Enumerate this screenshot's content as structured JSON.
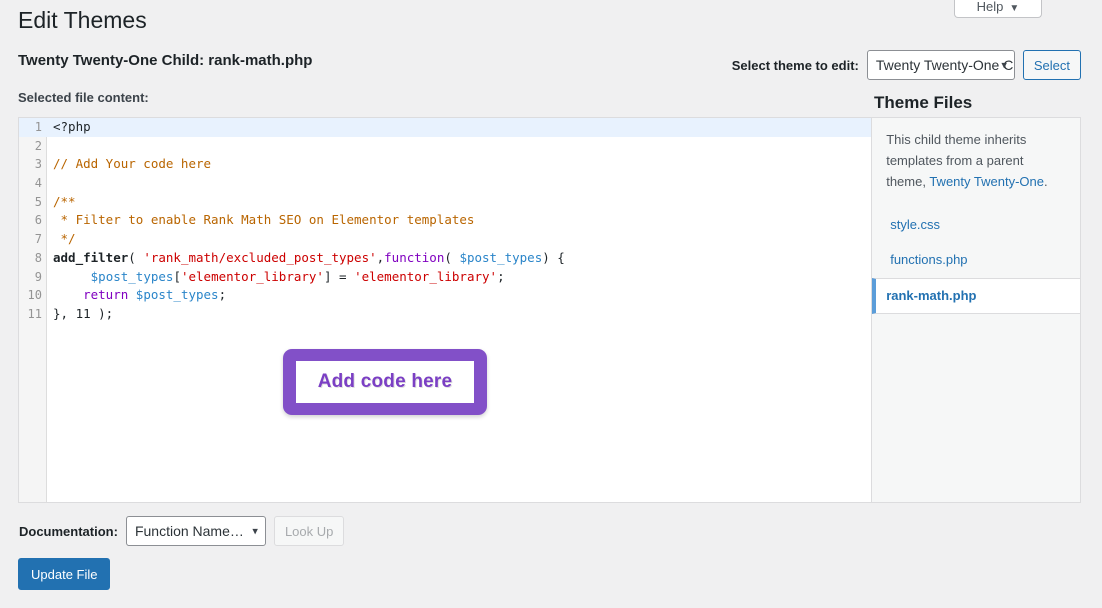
{
  "help_tab": {
    "label": "Help",
    "caret": "chevron-down-icon"
  },
  "header": {
    "page_title": "Edit Themes",
    "file_heading": "Twenty Twenty-One Child: rank-math.php",
    "selected_file_label": "Selected file content:"
  },
  "theme_selector": {
    "label": "Select theme to edit:",
    "value": "Twenty Twenty-One Child",
    "select_button": "Select"
  },
  "editor": {
    "lines": [
      {
        "n": "1",
        "active": true,
        "tokens": [
          {
            "t": "<?php",
            "c": "tok-plain"
          }
        ]
      },
      {
        "n": "2",
        "active": false,
        "tokens": [
          {
            "t": "",
            "c": "tok-plain"
          }
        ]
      },
      {
        "n": "3",
        "active": false,
        "tokens": [
          {
            "t": "// Add Your code here",
            "c": "tok-comment"
          }
        ]
      },
      {
        "n": "4",
        "active": false,
        "tokens": [
          {
            "t": "",
            "c": "tok-plain"
          }
        ]
      },
      {
        "n": "5",
        "active": false,
        "tokens": [
          {
            "t": "/**",
            "c": "tok-comment"
          }
        ]
      },
      {
        "n": "6",
        "active": false,
        "tokens": [
          {
            "t": " * Filter to enable Rank Math SEO on Elementor templates",
            "c": "tok-comment"
          }
        ]
      },
      {
        "n": "7",
        "active": false,
        "tokens": [
          {
            "t": " */",
            "c": "tok-comment"
          }
        ]
      },
      {
        "n": "8",
        "active": false,
        "tokens": [
          {
            "t": "add_filter",
            "c": "tok-fn"
          },
          {
            "t": "( ",
            "c": "tok-plain"
          },
          {
            "t": "'rank_math/excluded_post_types'",
            "c": "tok-string"
          },
          {
            "t": ",",
            "c": "tok-plain"
          },
          {
            "t": "function",
            "c": "tok-kw"
          },
          {
            "t": "( ",
            "c": "tok-plain"
          },
          {
            "t": "$post_types",
            "c": "tok-var"
          },
          {
            "t": ") {",
            "c": "tok-plain"
          }
        ]
      },
      {
        "n": "9",
        "active": false,
        "tokens": [
          {
            "t": "     ",
            "c": "tok-plain"
          },
          {
            "t": "$post_types",
            "c": "tok-var"
          },
          {
            "t": "[",
            "c": "tok-plain"
          },
          {
            "t": "'elementor_library'",
            "c": "tok-string"
          },
          {
            "t": "] = ",
            "c": "tok-plain"
          },
          {
            "t": "'elementor_library'",
            "c": "tok-string"
          },
          {
            "t": ";",
            "c": "tok-plain"
          }
        ]
      },
      {
        "n": "10",
        "active": false,
        "tokens": [
          {
            "t": "    ",
            "c": "tok-plain"
          },
          {
            "t": "return",
            "c": "tok-kw"
          },
          {
            "t": " ",
            "c": "tok-plain"
          },
          {
            "t": "$post_types",
            "c": "tok-var"
          },
          {
            "t": ";",
            "c": "tok-plain"
          }
        ]
      },
      {
        "n": "11",
        "active": false,
        "tokens": [
          {
            "t": "}, 11 );",
            "c": "tok-plain"
          }
        ]
      }
    ]
  },
  "annotation": {
    "text": "Add code here",
    "color": "#8250c8",
    "text_color": "#7b3fc4"
  },
  "sidebar": {
    "heading": "Theme Files",
    "note_prefix": "This child theme inherits templates from a parent theme, ",
    "note_link": "Twenty Twenty-One",
    "note_suffix": ".",
    "files": [
      {
        "label": "style.css",
        "selected": false
      },
      {
        "label": "functions.php",
        "selected": false
      },
      {
        "label": "rank-math.php",
        "selected": true
      }
    ]
  },
  "footer": {
    "documentation_label": "Documentation:",
    "documentation_value": "Function Name…",
    "look_up_button": "Look Up",
    "update_file_button": "Update File"
  }
}
